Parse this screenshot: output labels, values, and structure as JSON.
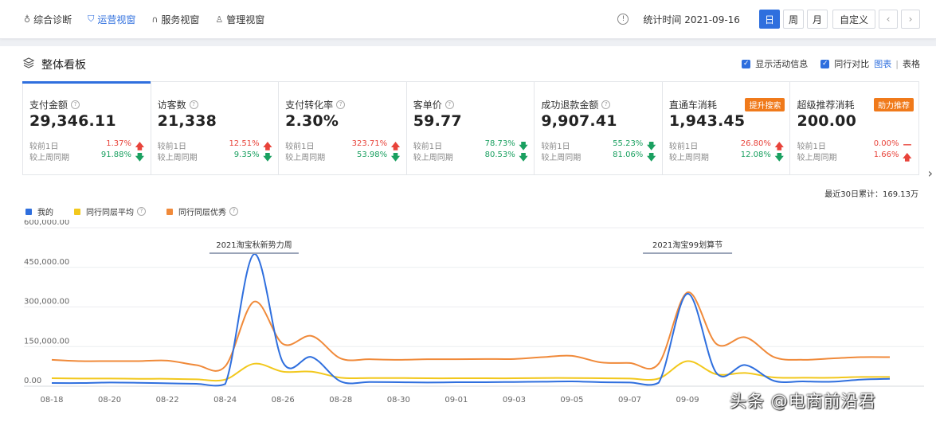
{
  "nav": {
    "items": [
      {
        "label": "综合诊断",
        "icon": "bulb-icon",
        "active": false
      },
      {
        "label": "运营视窗",
        "icon": "shield-icon",
        "active": true
      },
      {
        "label": "服务视窗",
        "icon": "headset-icon",
        "active": false
      },
      {
        "label": "管理视窗",
        "icon": "person-icon",
        "active": false
      }
    ]
  },
  "toolbar": {
    "stat_time": "统计时间 2021-09-16",
    "day": "日",
    "week": "周",
    "month": "月",
    "custom": "自定义",
    "prev": "‹",
    "next": "›"
  },
  "panel": {
    "title": "整体看板",
    "show_activity": "显示活动信息",
    "peer_compare": "同行对比",
    "view_chart": "图表",
    "view_table": "表格",
    "view_sep": "|"
  },
  "cards": [
    {
      "name": "支付金额",
      "value": "29,346.11",
      "badge": "",
      "d1_label": "较前1日",
      "d1_pct": "1.37%",
      "d1_dir": "up",
      "w_label": "较上周同期",
      "w_pct": "91.88%",
      "w_dir": "down"
    },
    {
      "name": "访客数",
      "value": "21,338",
      "badge": "",
      "d1_label": "较前1日",
      "d1_pct": "12.51%",
      "d1_dir": "up",
      "w_label": "较上周同期",
      "w_pct": "9.35%",
      "w_dir": "down"
    },
    {
      "name": "支付转化率",
      "value": "2.30%",
      "badge": "",
      "d1_label": "较前1日",
      "d1_pct": "323.71%",
      "d1_dir": "up",
      "w_label": "较上周同期",
      "w_pct": "53.98%",
      "w_dir": "down"
    },
    {
      "name": "客单价",
      "value": "59.77",
      "badge": "",
      "d1_label": "较前1日",
      "d1_pct": "78.73%",
      "d1_dir": "down",
      "w_label": "较上周同期",
      "w_pct": "80.53%",
      "w_dir": "down"
    },
    {
      "name": "成功退款金额",
      "value": "9,907.41",
      "badge": "",
      "d1_label": "较前1日",
      "d1_pct": "55.23%",
      "d1_dir": "down",
      "w_label": "较上周同期",
      "w_pct": "81.06%",
      "w_dir": "down"
    },
    {
      "name": "直通车消耗",
      "value": "1,943.45",
      "badge": "提升搜索",
      "d1_label": "较前1日",
      "d1_pct": "26.80%",
      "d1_dir": "up",
      "w_label": "较上周同期",
      "w_pct": "12.08%",
      "w_dir": "down"
    },
    {
      "name": "超级推荐消耗",
      "value": "200.00",
      "badge": "助力推荐",
      "d1_label": "较前1日",
      "d1_pct": "0.00%",
      "d1_dir": "flat",
      "w_label": "较上周同期",
      "w_pct": "1.66%",
      "w_dir": "up"
    }
  ],
  "cumulative": "最近30日累计：169.13万",
  "legend": [
    {
      "name": "我的",
      "color": "#2f6fde"
    },
    {
      "name": "同行同层平均",
      "color": "#f2c81d"
    },
    {
      "name": "同行同层优秀",
      "color": "#f08a3a"
    }
  ],
  "watermark": "头条 @电商前沿君",
  "chart_data": {
    "type": "line",
    "x": [
      "08-18",
      "08-19",
      "08-20",
      "08-21",
      "08-22",
      "08-23",
      "08-24",
      "08-25",
      "08-26",
      "08-27",
      "08-28",
      "08-29",
      "08-30",
      "08-31",
      "09-01",
      "09-02",
      "09-03",
      "09-04",
      "09-05",
      "09-06",
      "09-07",
      "09-08",
      "09-09",
      "09-10",
      "09-11",
      "09-12",
      "09-13",
      "09-14",
      "09-15",
      "09-16"
    ],
    "x_tick_labels": [
      "08-18",
      "08-20",
      "08-22",
      "08-24",
      "08-26",
      "08-28",
      "08-30",
      "09-01",
      "09-03",
      "09-05",
      "09-07",
      "09-09"
    ],
    "y_tick_labels": [
      "0.00",
      "150,000.00",
      "300,000.00",
      "450,000.00",
      "600,000.00"
    ],
    "ylim": [
      0,
      600000
    ],
    "series": [
      {
        "name": "我的",
        "color": "#2f6fde",
        "values": [
          12000,
          12000,
          14000,
          13000,
          11000,
          9000,
          8000,
          500000,
          90000,
          110000,
          18000,
          16000,
          15000,
          14000,
          15000,
          15000,
          16000,
          17000,
          18000,
          15000,
          14000,
          13000,
          350000,
          50000,
          80000,
          20000,
          18000,
          17000,
          25000,
          28000
        ]
      },
      {
        "name": "同行同层平均",
        "color": "#f2c81d",
        "values": [
          30000,
          29000,
          29000,
          28000,
          28000,
          26000,
          25000,
          85000,
          55000,
          55000,
          32000,
          31000,
          31000,
          30000,
          30000,
          30000,
          30000,
          31000,
          31000,
          30000,
          29000,
          29000,
          95000,
          45000,
          50000,
          33000,
          32000,
          32000,
          35000,
          35000
        ]
      },
      {
        "name": "同行同层优秀",
        "color": "#f08a3a",
        "values": [
          100000,
          95000,
          95000,
          95000,
          97000,
          80000,
          75000,
          320000,
          160000,
          190000,
          105000,
          102000,
          100000,
          102000,
          102000,
          103000,
          103000,
          110000,
          115000,
          90000,
          88000,
          85000,
          355000,
          160000,
          185000,
          110000,
          100000,
          105000,
          110000,
          110000
        ]
      }
    ],
    "annotations": [
      {
        "text": "2021淘宝秋新势力周",
        "x": "08-25"
      },
      {
        "text": "2021淘宝99划算节",
        "x": "09-09"
      }
    ],
    "grid": true
  }
}
